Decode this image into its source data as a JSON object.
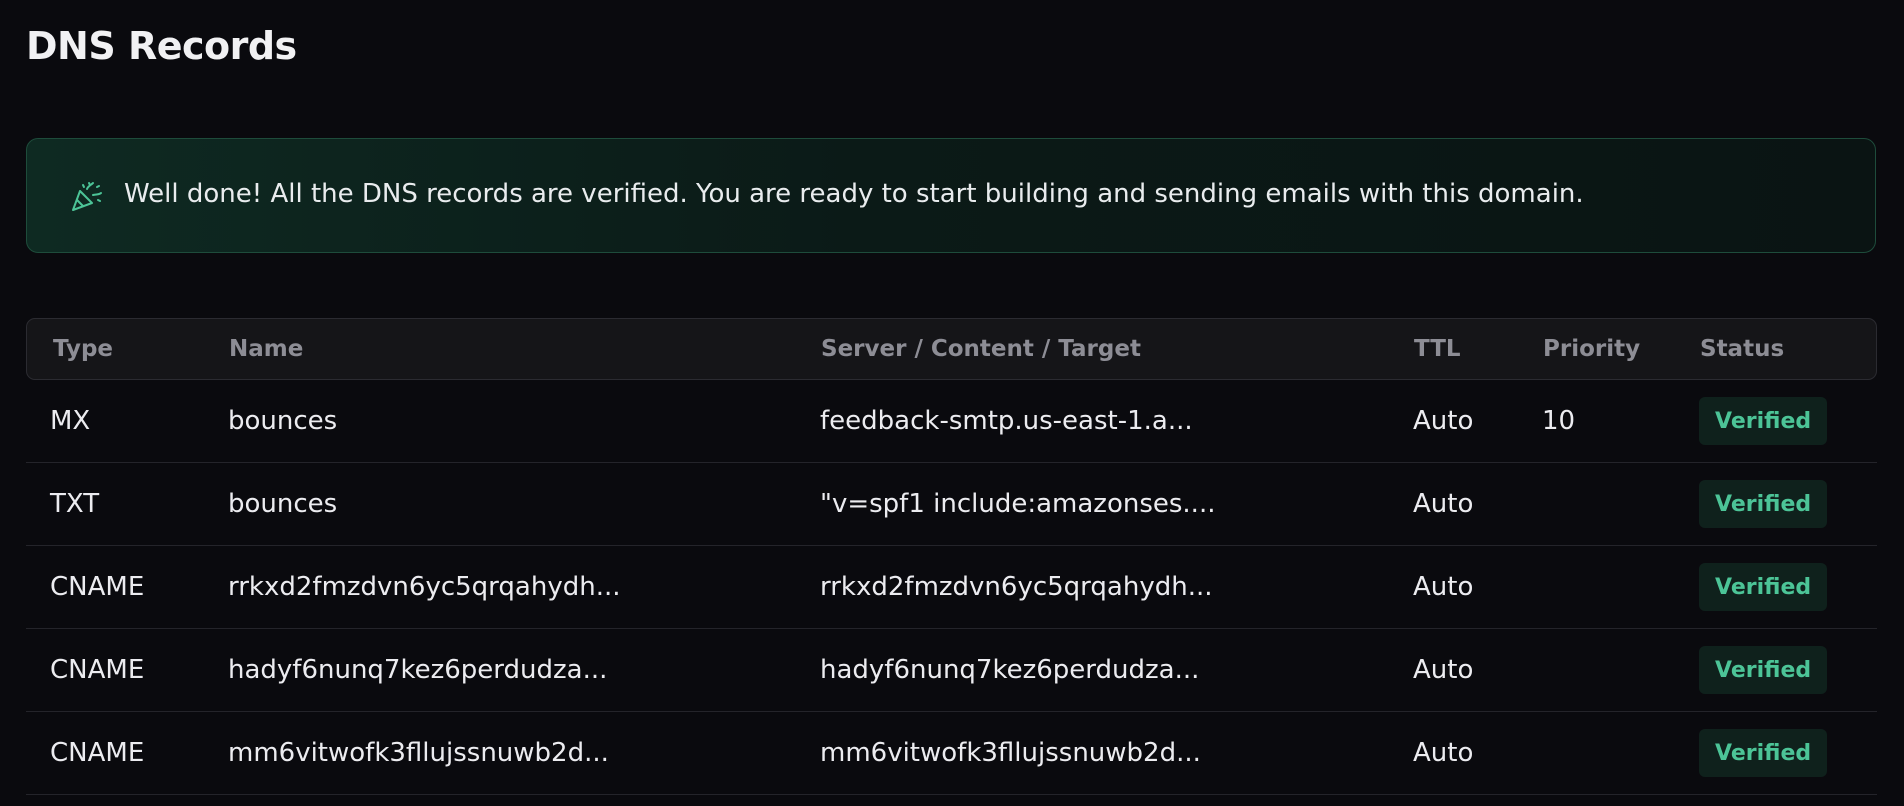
{
  "page": {
    "title": "DNS Records"
  },
  "banner": {
    "icon": "party-popper-icon",
    "message": "Well done! All the DNS records are verified. You are ready to start building and sending emails with this domain."
  },
  "table": {
    "headers": {
      "type": "Type",
      "name": "Name",
      "target": "Server / Content / Target",
      "ttl": "TTL",
      "priority": "Priority",
      "status": "Status"
    },
    "rows": [
      {
        "type": "MX",
        "name": "bounces",
        "target": "feedback-smtp.us-east-1.a...",
        "ttl": "Auto",
        "priority": "10",
        "status": "Verified"
      },
      {
        "type": "TXT",
        "name": "bounces",
        "target": "\"v=spf1 include:amazonses....",
        "ttl": "Auto",
        "priority": "",
        "status": "Verified"
      },
      {
        "type": "CNAME",
        "name": "rrkxd2fmzdvn6yc5qrqahydh...",
        "target": "rrkxd2fmzdvn6yc5qrqahydh...",
        "ttl": "Auto",
        "priority": "",
        "status": "Verified"
      },
      {
        "type": "CNAME",
        "name": "hadyf6nunq7kez6perdudza...",
        "target": "hadyf6nunq7kez6perdudza...",
        "ttl": "Auto",
        "priority": "",
        "status": "Verified"
      },
      {
        "type": "CNAME",
        "name": "mm6vitwofk3fllujssnuwb2d...",
        "target": "mm6vitwofk3fllujssnuwb2d...",
        "ttl": "Auto",
        "priority": "",
        "status": "Verified"
      }
    ]
  },
  "colors": {
    "background": "#0a0a0e",
    "banner_border": "#1e4c3b",
    "verified_text": "#4cc497",
    "verified_bg": "#0f211c",
    "header_text": "#8d8d95"
  }
}
